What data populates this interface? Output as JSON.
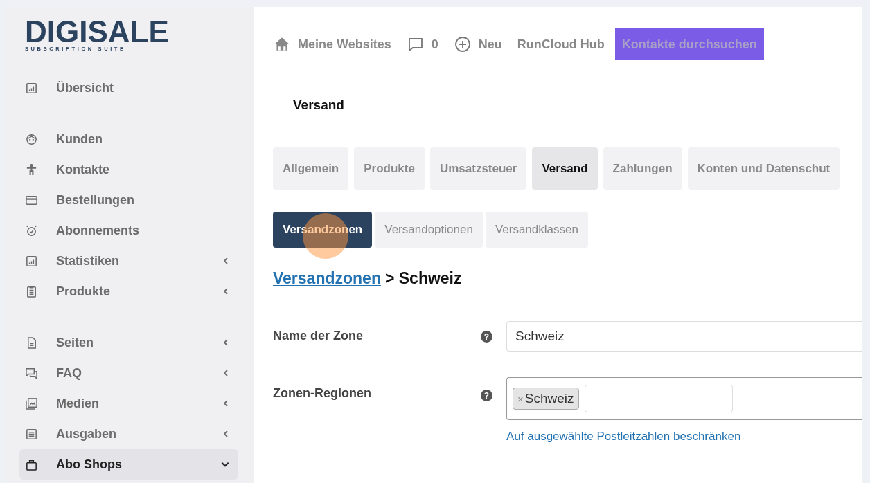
{
  "logo": {
    "name": "DIGISALE",
    "tagline": "SUBSCRIPTION SUITE"
  },
  "sidebar": {
    "groups": [
      {
        "items": [
          {
            "label": "Übersicht",
            "expandable": false,
            "expanded": false,
            "selected": false
          }
        ]
      },
      {
        "items": [
          {
            "label": "Kunden",
            "expandable": false,
            "expanded": false,
            "selected": false
          },
          {
            "label": "Kontakte",
            "expandable": false,
            "expanded": false,
            "selected": false
          },
          {
            "label": "Bestellungen",
            "expandable": false,
            "expanded": false,
            "selected": false
          },
          {
            "label": "Abonnements",
            "expandable": false,
            "expanded": false,
            "selected": false
          },
          {
            "label": "Statistiken",
            "expandable": true,
            "expanded": false,
            "selected": false
          },
          {
            "label": "Produkte",
            "expandable": true,
            "expanded": false,
            "selected": false
          }
        ]
      },
      {
        "items": [
          {
            "label": "Seiten",
            "expandable": true,
            "expanded": false,
            "selected": false
          },
          {
            "label": "FAQ",
            "expandable": true,
            "expanded": false,
            "selected": false
          },
          {
            "label": "Medien",
            "expandable": true,
            "expanded": false,
            "selected": false
          },
          {
            "label": "Ausgaben",
            "expandable": true,
            "expanded": false,
            "selected": false
          },
          {
            "label": "Abo Shops",
            "expandable": true,
            "expanded": true,
            "selected": true
          }
        ]
      }
    ]
  },
  "toolbar": {
    "sites": "Meine Websites",
    "comments": "0",
    "new": "Neu",
    "hub": "RunCloud Hub",
    "search_button": "Kontakte durchsuchen"
  },
  "page_title": "Versand",
  "tabs": [
    {
      "label": "Allgemein",
      "selected": false
    },
    {
      "label": "Produkte",
      "selected": false
    },
    {
      "label": "Umsatzsteuer",
      "selected": false
    },
    {
      "label": "Versand",
      "selected": true
    },
    {
      "label": "Zahlungen",
      "selected": false
    },
    {
      "label": "Konten und Datenschut",
      "selected": false
    }
  ],
  "subtabs": [
    {
      "label": "Versandzonen",
      "selected": true
    },
    {
      "label": "Versandoptionen",
      "selected": false
    },
    {
      "label": "Versandklassen",
      "selected": false
    }
  ],
  "breadcrumb": {
    "link": "Versandzonen",
    "current": "> Schweiz"
  },
  "form": {
    "zone_name": {
      "label": "Name der Zone",
      "help": "?",
      "value": "Schweiz"
    },
    "regions": {
      "label": "Zonen-Regionen",
      "help": "?",
      "tags": [
        {
          "remove": "×",
          "label": "Schweiz"
        }
      ],
      "link": "Auf ausgewählte Postleitzahlen beschränken"
    }
  }
}
